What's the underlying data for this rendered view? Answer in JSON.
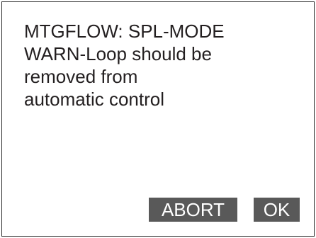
{
  "dialog": {
    "message_lines": [
      "MTGFLOW: SPL-MODE",
      "WARN-Loop should be",
      "removed from",
      "automatic control"
    ],
    "abort_label": "ABORT",
    "ok_label": "OK"
  },
  "colors": {
    "button_background": "#595959",
    "button_text": "#ffffff",
    "text": "#231f20",
    "border": "#2b2b2b",
    "background": "#ffffff"
  }
}
